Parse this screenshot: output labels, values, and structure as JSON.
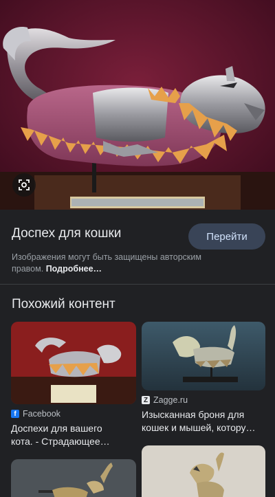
{
  "hero": {
    "alt": "cat armor in a museum display"
  },
  "lens": {
    "icon": "lens-icon"
  },
  "result": {
    "title": "Доспех для кошки",
    "go_button": "Перейти",
    "copyright_text": "Изображения могут быть защищены авторским правом.",
    "more_link": "Подробнее…"
  },
  "related": {
    "heading": "Похожий контент",
    "cards": [
      {
        "source": "Facebook",
        "source_icon": "facebook-icon",
        "title_line1": "Доспехи для вашего",
        "title_line2": "кота. - Страдающее…"
      },
      {
        "source": "Zagge.ru",
        "source_icon": "zagge-icon",
        "title_line1": "Изысканная броня для",
        "title_line2": "кошек и мышей, котору…"
      },
      {
        "source": "",
        "source_icon": "",
        "title_line1": "",
        "title_line2": ""
      },
      {
        "source": "",
        "source_icon": "",
        "title_line1": "",
        "title_line2": ""
      }
    ]
  },
  "colors": {
    "background": "#202124",
    "button_bg": "#394457",
    "button_text": "#d2e3fc",
    "facebook_blue": "#1877f2"
  }
}
